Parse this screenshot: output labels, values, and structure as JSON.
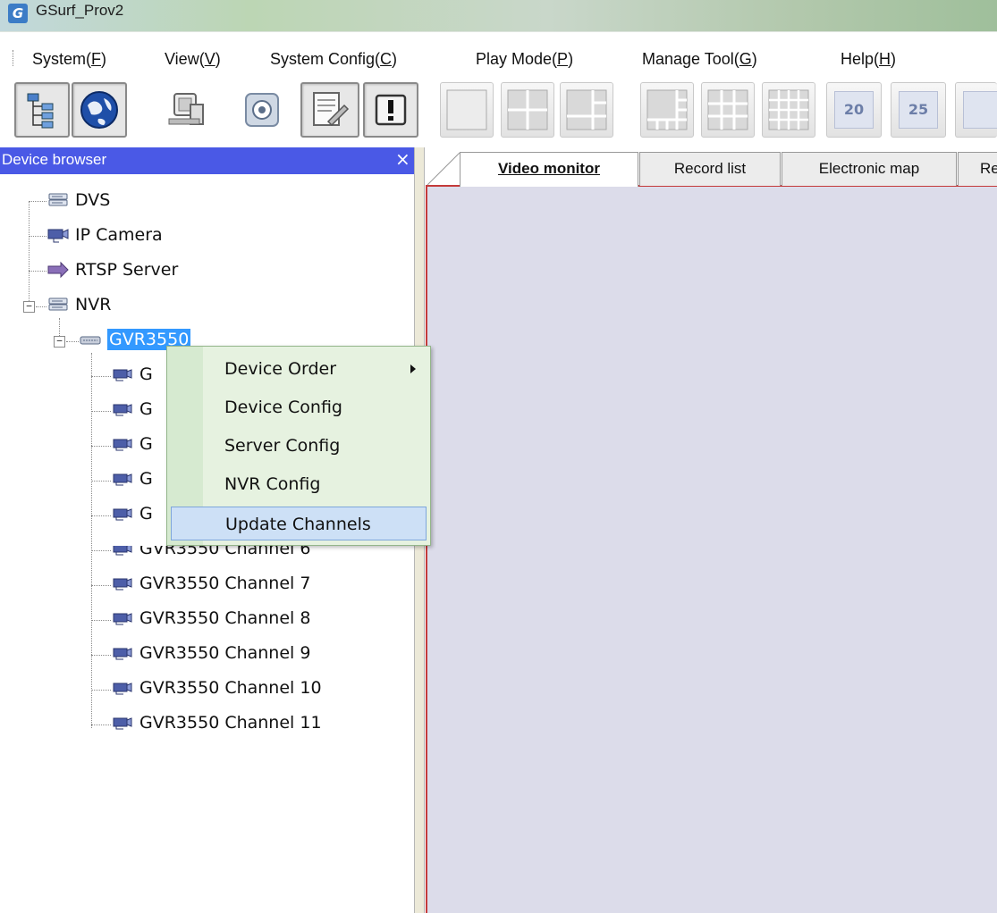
{
  "window": {
    "title": "GSurf_Prov2",
    "app_icon_glyph": "G"
  },
  "menu": {
    "items": [
      {
        "label": "System(",
        "accel": "F",
        "tail": ")"
      },
      {
        "label": "View(",
        "accel": "V",
        "tail": ")"
      },
      {
        "label": "System Config(",
        "accel": "C",
        "tail": ")"
      },
      {
        "label": "Play Mode(",
        "accel": "P",
        "tail": ")"
      },
      {
        "label": "Manage Tool(",
        "accel": "G",
        "tail": ")"
      },
      {
        "label": "Help(",
        "accel": "H",
        "tail": ")"
      }
    ]
  },
  "toolbar": {
    "icons": [
      "device-tree-icon",
      "globe-icon",
      "record-machine-icon",
      "ptz-control-icon",
      "edit-config-icon",
      "alarm-icon",
      "layout-1-icon",
      "layout-4-icon",
      "layout-6-icon",
      "layout-8-icon",
      "layout-9-icon",
      "layout-16-icon",
      "layout-20-icon",
      "layout-25-icon"
    ],
    "layout_20_label": "20",
    "layout_25_label": "25"
  },
  "device_browser": {
    "title": "Device browser",
    "close_glyph": "×"
  },
  "tree": {
    "root_items": [
      "DVS",
      "IP Camera",
      "RTSP Server",
      "NVR"
    ],
    "nvr_device": "GVR3550",
    "channel_prefix": "G",
    "channels": [
      "GVR3550 Channel 6",
      "GVR3550 Channel 7",
      "GVR3550 Channel 8",
      "GVR3550 Channel 9",
      "GVR3550 Channel 10",
      "GVR3550 Channel 11"
    ]
  },
  "tabs": [
    {
      "label": "Video monitor",
      "active": true
    },
    {
      "label": "Record list",
      "active": false
    },
    {
      "label": "Electronic map",
      "active": false
    },
    {
      "label": "Re",
      "active": false
    }
  ],
  "context_menu": {
    "items": [
      {
        "label": "Device Order",
        "submenu": true
      },
      {
        "label": "Device Config",
        "submenu": false
      },
      {
        "label": "Server Config",
        "submenu": false
      },
      {
        "label": "NVR Config",
        "submenu": false
      },
      {
        "label": "Update Channels",
        "submenu": false,
        "highlighted": true
      }
    ]
  },
  "colors": {
    "panel_header": "#4a59e6",
    "selection": "#3399ff",
    "tab_accent": "#c43a3a",
    "video_bg": "#dcdcea",
    "context_bg": "#e6f2e0"
  }
}
